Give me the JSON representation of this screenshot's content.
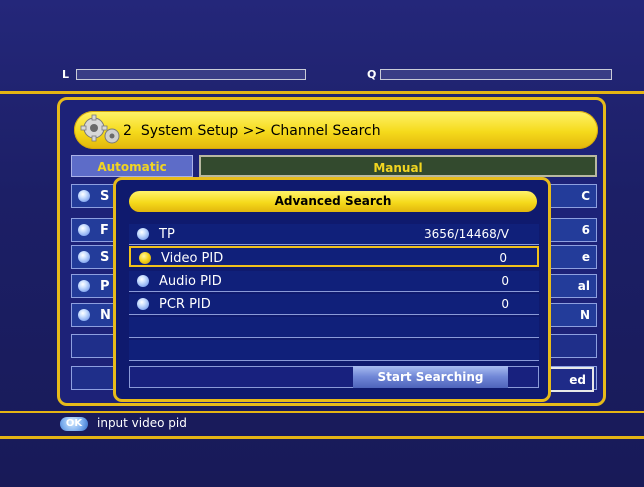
{
  "signal": {
    "level_label": "L",
    "quality_label": "Q"
  },
  "header": {
    "menu_number": "2",
    "breadcrumb": "System Setup >> Channel Search"
  },
  "tabs": [
    {
      "label": "Automatic"
    },
    {
      "label": "Manual"
    }
  ],
  "background_rows": [
    {
      "letter": "S",
      "right": "C"
    },
    {
      "letter": "F",
      "right": "6"
    },
    {
      "letter": "S",
      "right": "e"
    },
    {
      "letter": "P",
      "right": "al"
    },
    {
      "letter": "N",
      "right": "N"
    }
  ],
  "background_button": {
    "label": "ed"
  },
  "dialog": {
    "title": "Advanced Search",
    "rows": [
      {
        "label": "TP",
        "value": "3656/14468/V"
      },
      {
        "label": "Video PID",
        "value": "0",
        "selected": true
      },
      {
        "label": "Audio PID",
        "value": "0"
      },
      {
        "label": "PCR PID",
        "value": "0"
      }
    ],
    "start_button": "Start Searching"
  },
  "help": {
    "key": "OK",
    "text": "input video pid"
  },
  "colors": {
    "gold": "#e7bb1a",
    "background": "#1b1e5c",
    "row_blue": "#233c9a"
  }
}
